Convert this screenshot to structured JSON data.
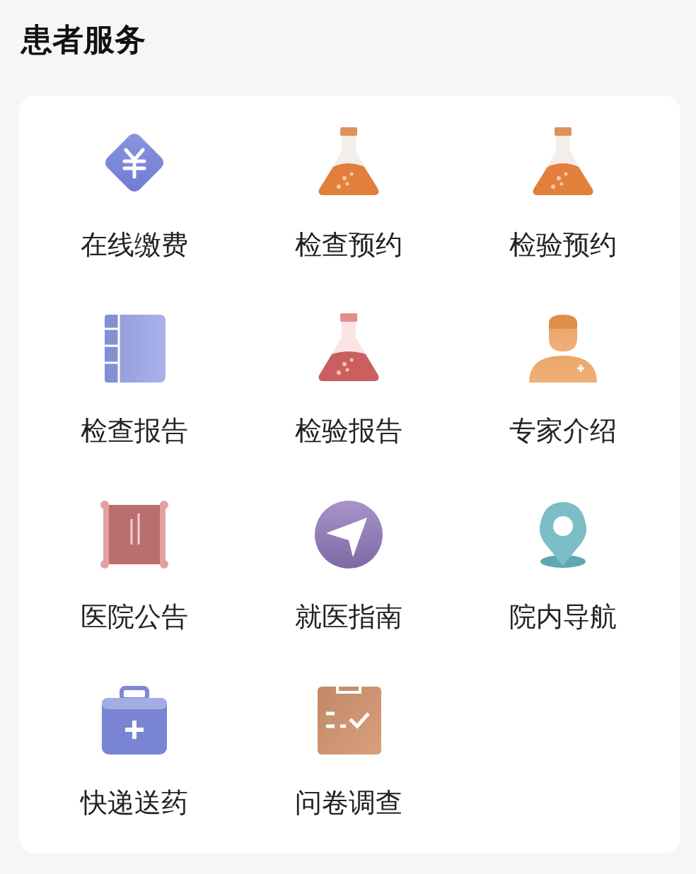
{
  "title": "患者服务",
  "services": [
    {
      "label": "在线缴费",
      "kind": "payment"
    },
    {
      "label": "检查预约",
      "kind": "flask"
    },
    {
      "label": "检验预约",
      "kind": "flask"
    },
    {
      "label": "检查报告",
      "kind": "notebook"
    },
    {
      "label": "检验报告",
      "kind": "flask-red"
    },
    {
      "label": "专家介绍",
      "kind": "doctor"
    },
    {
      "label": "医院公告",
      "kind": "board"
    },
    {
      "label": "就医指南",
      "kind": "compass"
    },
    {
      "label": "院内导航",
      "kind": "pin"
    },
    {
      "label": "快递送药",
      "kind": "medkit"
    },
    {
      "label": "问卷调查",
      "kind": "clipboard"
    }
  ]
}
